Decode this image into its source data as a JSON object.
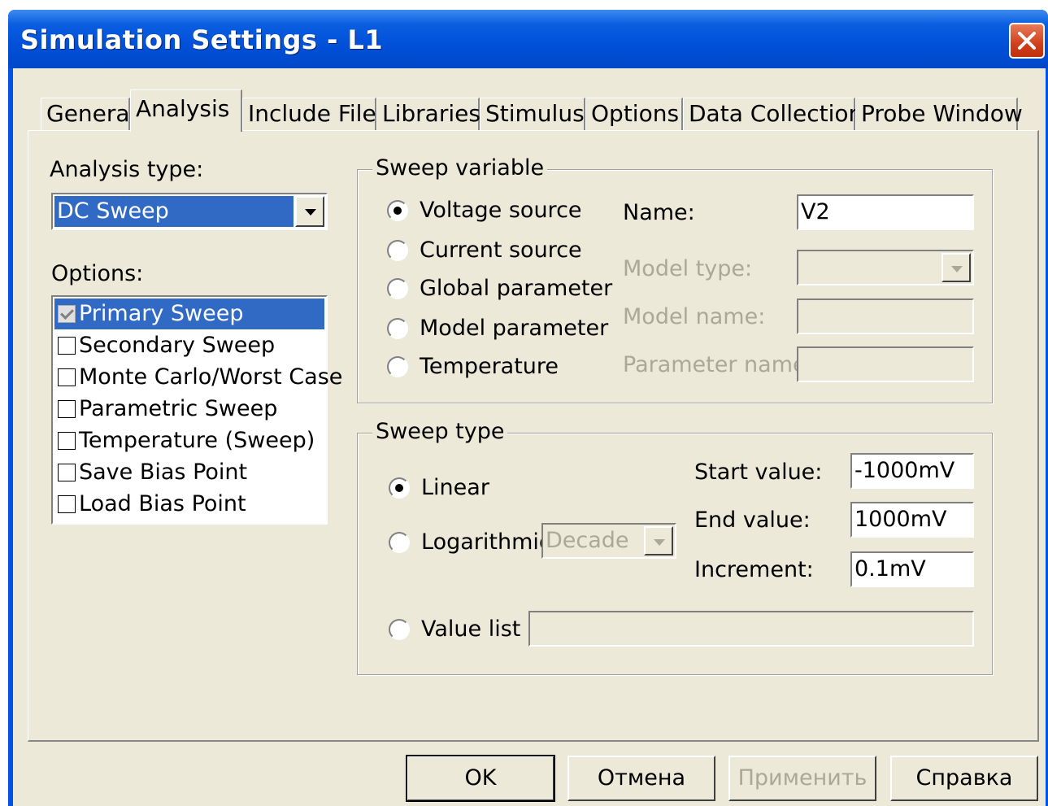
{
  "window": {
    "title": "Simulation Settings - L1"
  },
  "tabs": [
    "General",
    "Analysis",
    "Include Files",
    "Libraries",
    "Stimulus",
    "Options",
    "Data Collection",
    "Probe Window"
  ],
  "analysis": {
    "type_label": "Analysis type:",
    "type_value": "DC Sweep",
    "options_label": "Options:",
    "options": [
      {
        "label": "Primary Sweep",
        "checked": true,
        "selected": true
      },
      {
        "label": "Secondary Sweep",
        "checked": false
      },
      {
        "label": "Monte Carlo/Worst Case",
        "checked": false
      },
      {
        "label": "Parametric Sweep",
        "checked": false
      },
      {
        "label": "Temperature (Sweep)",
        "checked": false
      },
      {
        "label": "Save Bias Point",
        "checked": false
      },
      {
        "label": "Load Bias Point",
        "checked": false
      }
    ]
  },
  "sweep_variable": {
    "title": "Sweep variable",
    "radios": [
      "Voltage source",
      "Current source",
      "Global parameter",
      "Model parameter",
      "Temperature"
    ],
    "selected": "Voltage source",
    "name_label": "Name:",
    "name_value": "V2",
    "model_type_label": "Model type:",
    "model_name_label": "Model name:",
    "parameter_name_label": "Parameter name:"
  },
  "sweep_type": {
    "title": "Sweep type",
    "linear_label": "Linear",
    "log_label": "Logarithmic",
    "log_select": "Decade",
    "value_list_label": "Value list",
    "selected": "Linear",
    "start_label": "Start value:",
    "start_value": "-1000mV",
    "end_label": "End value:",
    "end_value": "1000mV",
    "increment_label": "Increment:",
    "increment_value": "0.1mV"
  },
  "buttons": {
    "ok": "OK",
    "cancel": "Отмена",
    "apply": "Применить",
    "help": "Справка"
  }
}
